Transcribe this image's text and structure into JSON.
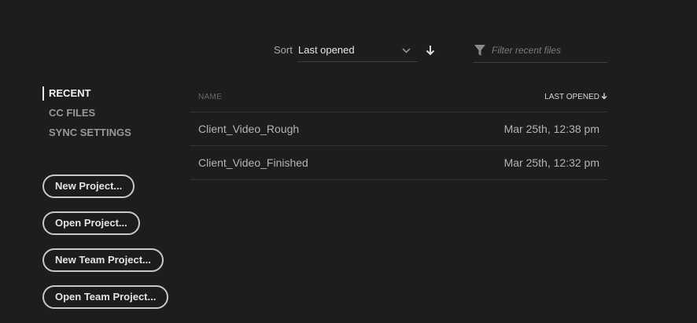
{
  "toolbar": {
    "sort_label": "Sort",
    "sort_value": "Last opened",
    "sort_direction_icon": "arrow-down-icon",
    "filter_icon": "funnel-icon",
    "filter_placeholder": "Filter recent files",
    "filter_value": ""
  },
  "nav": {
    "items": [
      {
        "label": "RECENT",
        "active": true
      },
      {
        "label": "CC FILES",
        "active": false
      },
      {
        "label": "SYNC SETTINGS",
        "active": false
      }
    ]
  },
  "actions": {
    "new_project": "New Project...",
    "open_project": "Open Project...",
    "new_team_project": "New Team Project...",
    "open_team_project": "Open Team Project..."
  },
  "table": {
    "columns": {
      "name": "NAME",
      "last_opened": "LAST OPENED"
    },
    "rows": [
      {
        "name": "Client_Video_Rough",
        "last_opened": "Mar 25th, 12:38 pm"
      },
      {
        "name": "Client_Video_Finished",
        "last_opened": "Mar 25th, 12:32 pm"
      }
    ]
  },
  "colors": {
    "background": "#1d1d1d",
    "active_text": "#f4f4f4",
    "muted_text": "#979797",
    "divider": "#363636"
  }
}
